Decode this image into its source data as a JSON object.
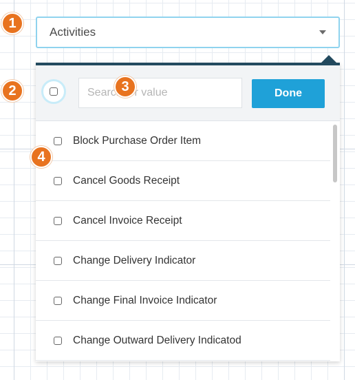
{
  "dropdown": {
    "selected_label": "Activities"
  },
  "search": {
    "placeholder": "Search for value",
    "value": ""
  },
  "done_button": {
    "label": "Done"
  },
  "items": [
    {
      "label": "Block Purchase Order Item",
      "checked": false
    },
    {
      "label": "Cancel Goods Receipt",
      "checked": false
    },
    {
      "label": "Cancel Invoice Receipt",
      "checked": false
    },
    {
      "label": "Change Delivery Indicator",
      "checked": false
    },
    {
      "label": "Change Final Invoice Indicator",
      "checked": false
    },
    {
      "label": "Change Outward Delivery Indicatod",
      "checked": false
    }
  ],
  "callouts": [
    "1",
    "2",
    "3",
    "4"
  ],
  "colors": {
    "accent": "#1fa1d8",
    "panel_border": "#234a5f",
    "callout": "#e8731f",
    "focus_ring": "#8fd3ee"
  },
  "icons": {
    "dropdown_caret": "chevron-down-icon"
  }
}
